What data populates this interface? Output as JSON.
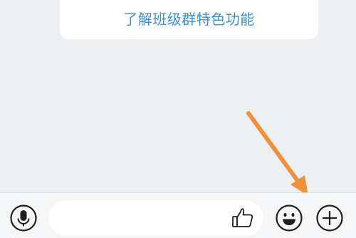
{
  "card": {
    "link_text": "了解班级群特色功能"
  },
  "annotation": {
    "arrow_color": "#f0903a"
  },
  "input_bar": {
    "voice_icon": "microphone-icon",
    "message_input_value": "",
    "like_icon": "thumbs-up-icon",
    "emoji_icon": "smiley-icon",
    "more_icon": "plus-icon"
  },
  "colors": {
    "background": "#edf0f2",
    "link": "#3a8fcf",
    "icon": "#1f1f1f"
  }
}
